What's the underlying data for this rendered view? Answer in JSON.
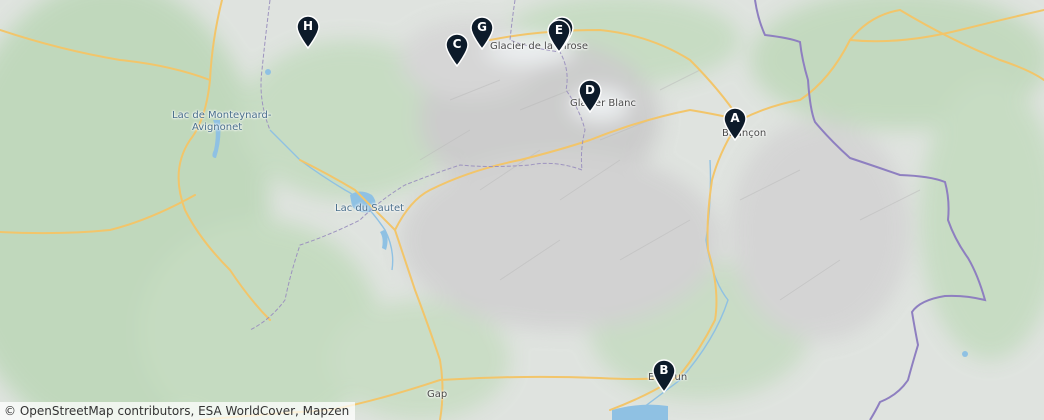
{
  "map": {
    "attribution": "© OpenStreetMap contributors, ESA WorldCover, Mapzen",
    "places": [
      {
        "id": "lac-monteynard-1",
        "text": "Lac de Monteynard-",
        "kind": "water"
      },
      {
        "id": "lac-monteynard-2",
        "text": "Avignonet",
        "kind": "water"
      },
      {
        "id": "lac-du-sautet",
        "text": "Lac du Sautet",
        "kind": "water"
      },
      {
        "id": "glacier-girose",
        "text": "Glacier de la Girose",
        "kind": "land"
      },
      {
        "id": "glacier-blanc",
        "text": "Glacier Blanc",
        "kind": "land"
      },
      {
        "id": "briancon",
        "text": "Briançon",
        "kind": "land"
      },
      {
        "id": "embrun",
        "text": "Embrun",
        "kind": "land"
      },
      {
        "id": "gap",
        "text": "Gap",
        "kind": "land"
      }
    ],
    "markers": [
      {
        "label": "A"
      },
      {
        "label": "B"
      },
      {
        "label": "C"
      },
      {
        "label": "D"
      },
      {
        "label": "E"
      },
      {
        "label": "F"
      },
      {
        "label": "G"
      },
      {
        "label": "H"
      }
    ],
    "colors": {
      "land": "#dfe3df",
      "forest": "#c6dcc2",
      "rock": "#cfcfcf",
      "road": "#f2c56a",
      "water": "#8fc1e3",
      "border": "#8e7fc0",
      "marker": "#0d1b2a"
    }
  }
}
